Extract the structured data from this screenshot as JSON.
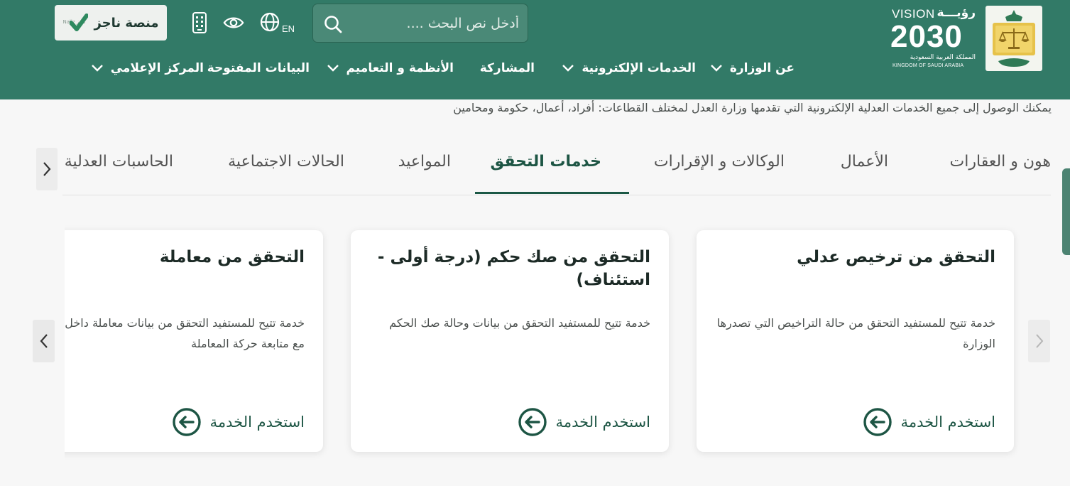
{
  "header": {
    "nafith_label": "منصة ناجز",
    "nafith_logo_text": "ناجز Najiz",
    "lang_label": "EN",
    "search_placeholder": "أدخل نص البحث ....",
    "vision": {
      "top": "VISION",
      "top_ar": "رؤيـــة",
      "number": "2030",
      "sub_ar": "المملكة العربية السعودية",
      "sub_en": "KINGDOM OF SAUDI ARABIA"
    },
    "icons": [
      "mobile-icon",
      "eye-icon",
      "globe-icon",
      "search-icon"
    ],
    "colors": {
      "primary": "#327a67",
      "accent": "#1d5544"
    }
  },
  "nav": [
    {
      "label": "عن الوزارة",
      "has_dropdown": true
    },
    {
      "label": "الخدمات الإلكترونية",
      "has_dropdown": true
    },
    {
      "label": "المشاركة",
      "has_dropdown": false
    },
    {
      "label": "الأنظمة و التعاميم",
      "has_dropdown": true
    },
    {
      "label": "البيانات المفتوحة",
      "has_dropdown": false
    },
    {
      "label": "المركز الإعلامي",
      "has_dropdown": true
    }
  ],
  "intro": "يمكنك الوصول إلى جميع الخدمات العدلية الإلكترونية التي تقدمها وزارة العدل لمختلف القطاعات: أفراد، أعمال، حكومة ومحامين",
  "tabs": [
    {
      "label": "هون و العقارات",
      "active": false
    },
    {
      "label": "الأعمال",
      "active": false
    },
    {
      "label": "الوكالات و الإقرارات",
      "active": false
    },
    {
      "label": "خدمات التحقق",
      "active": true
    },
    {
      "label": "المواعيد",
      "active": false
    },
    {
      "label": "الحالات الاجتماعية",
      "active": false
    },
    {
      "label": "الحاسبات العدلية",
      "active": false
    }
  ],
  "cards": [
    {
      "title": "التحقق من ترخيص عدلي",
      "desc": "خدمة تتيح للمستفيد التحقق من حالة التراخيص التي تصدرها الوزارة",
      "action": "استخدم الخدمة"
    },
    {
      "title": "التحقق من صك حكم (درجة أولى - استئناف)",
      "desc": "خدمة تتيح للمستفيد التحقق من بيانات وحالة صك الحكم",
      "action": "استخدم الخدمة"
    },
    {
      "title": "التحقق من معاملة",
      "desc": "خدمة تتيح للمستفيد التحقق من بيانات معاملة داخل الوزارة، مع متابعة حركة المعاملة",
      "action": "استخدم الخدمة"
    }
  ]
}
